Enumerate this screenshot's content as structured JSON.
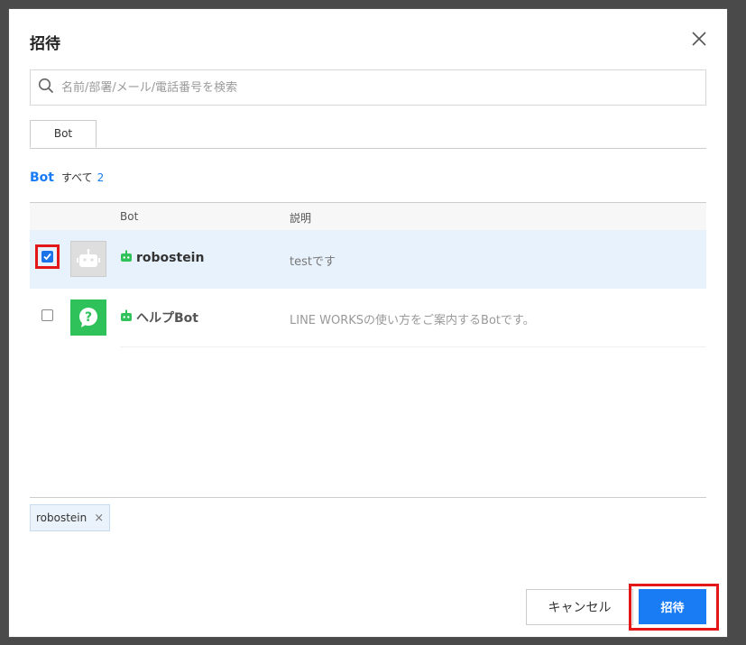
{
  "dialog": {
    "title": "招待",
    "search_placeholder": "名前/部署/メール/電話番号を検索",
    "tabs": [
      {
        "label": "Bot"
      }
    ],
    "category": {
      "label": "Bot",
      "all_label": "すべて",
      "count": "2"
    },
    "columns": {
      "bot": "Bot",
      "description": "説明"
    },
    "rows": [
      {
        "name": "robostein",
        "description": "testです",
        "checked": true
      },
      {
        "name": "ヘルプBot",
        "description": "LINE WORKSの使い方をご案内するBotです。",
        "checked": false
      }
    ],
    "selected_chips": [
      {
        "label": "robostein"
      }
    ],
    "buttons": {
      "cancel": "キャンセル",
      "invite": "招待"
    }
  },
  "colors": {
    "accent": "#1a7cf5",
    "highlight": "#e31717",
    "selected_row": "#e8f2fd",
    "bot_green": "#2fc25b"
  },
  "icons": [
    "close-icon",
    "search-icon",
    "bot-icon",
    "help-icon",
    "robot-avatar-icon",
    "chip-remove-icon",
    "checkmark-icon"
  ]
}
